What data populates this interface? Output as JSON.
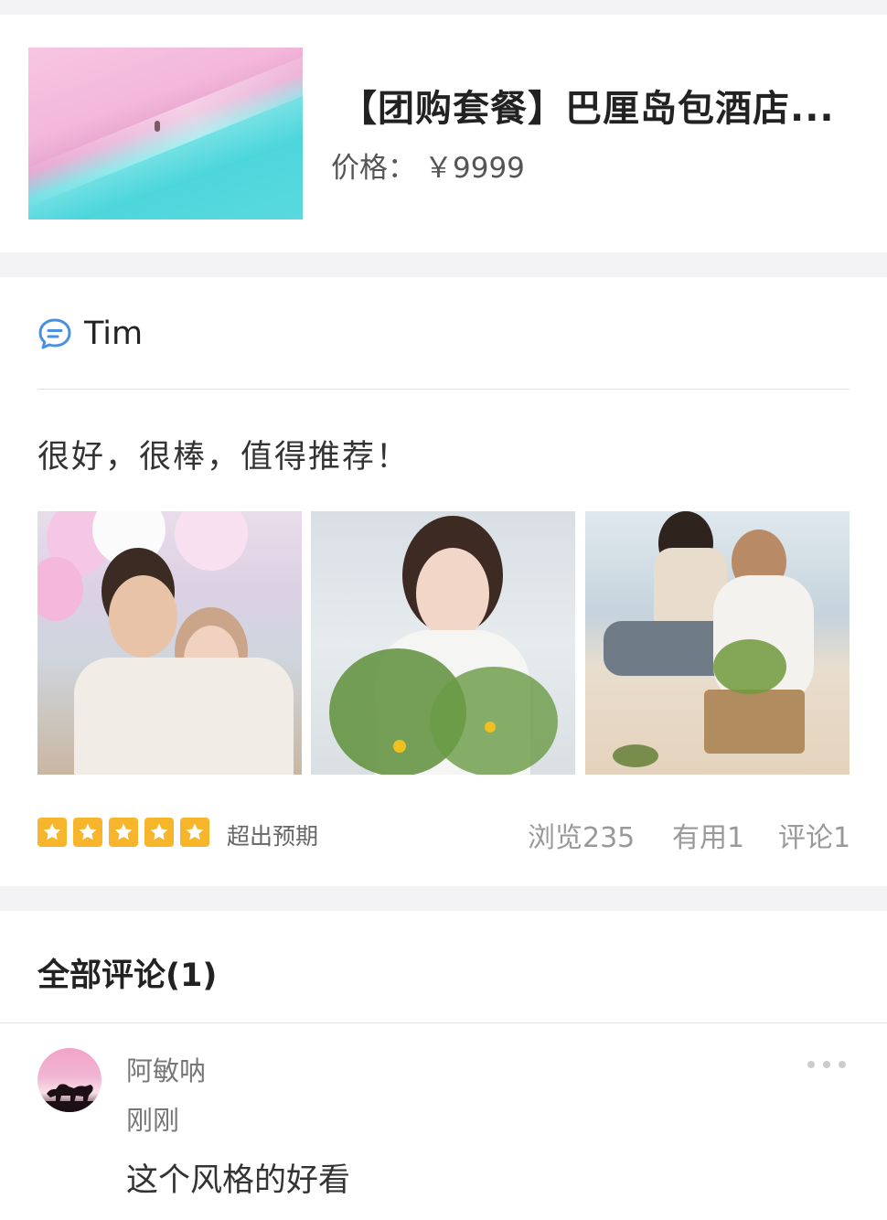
{
  "product": {
    "title": "【团购套餐】巴厘岛包酒店...",
    "price_label": "价格：",
    "price_value": "￥9999",
    "image_icon": "beach-photo"
  },
  "review": {
    "user": "Tim",
    "user_icon": "chat-bubble-icon",
    "text": "很好，很棒，值得推荐！",
    "photos": [
      "couple-balloons-photo",
      "woman-flowers-photo",
      "couple-beach-photo"
    ],
    "rating": 5,
    "rating_max": 5,
    "rating_text": "超出预期",
    "views": "浏览235",
    "useful": "有用1",
    "comments": "评论1"
  },
  "comments_section": {
    "header": "全部评论(1)",
    "items": [
      {
        "name": "阿敏呐",
        "time": "刚刚",
        "text": "这个风格的好看",
        "avatar_icon": "horses-sunset-avatar"
      }
    ]
  },
  "colors": {
    "accent_blue": "#4a90e2",
    "star_yellow": "#f7b52c",
    "background": "#f3f3f5"
  }
}
